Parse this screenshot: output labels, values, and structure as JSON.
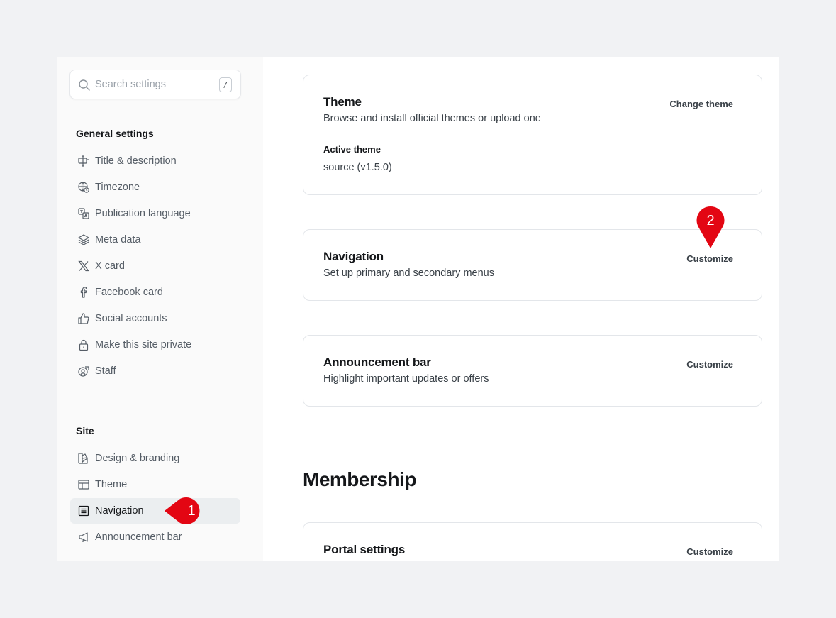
{
  "search": {
    "placeholder": "Search settings",
    "shortcut": "/"
  },
  "sidebar": {
    "general_title": "General settings",
    "general_items": [
      {
        "label": "Title & description",
        "icon": "title-icon"
      },
      {
        "label": "Timezone",
        "icon": "globe-clock-icon"
      },
      {
        "label": "Publication language",
        "icon": "language-icon"
      },
      {
        "label": "Meta data",
        "icon": "layers-icon"
      },
      {
        "label": "X card",
        "icon": "x-logo-icon"
      },
      {
        "label": "Facebook card",
        "icon": "facebook-icon"
      },
      {
        "label": "Social accounts",
        "icon": "thumbs-up-icon"
      },
      {
        "label": "Make this site private",
        "icon": "lock-icon"
      },
      {
        "label": "Staff",
        "icon": "staff-icon"
      }
    ],
    "site_title": "Site",
    "site_items": [
      {
        "label": "Design & branding",
        "icon": "paintbrush-icon"
      },
      {
        "label": "Theme",
        "icon": "layout-icon"
      },
      {
        "label": "Navigation",
        "icon": "navigation-list-icon",
        "active": true
      },
      {
        "label": "Announcement bar",
        "icon": "megaphone-icon"
      }
    ]
  },
  "main": {
    "theme_card": {
      "title": "Theme",
      "description": "Browse and install official themes or upload one",
      "action": "Change theme",
      "active_label": "Active theme",
      "active_value": "source (v1.5.0)"
    },
    "navigation_card": {
      "title": "Navigation",
      "description": "Set up primary and secondary menus",
      "action": "Customize"
    },
    "announcement_card": {
      "title": "Announcement bar",
      "description": "Highlight important updates or offers",
      "action": "Customize"
    },
    "membership_heading": "Membership",
    "portal_card": {
      "title": "Portal settings",
      "action": "Customize"
    }
  },
  "markers": [
    {
      "number": "1",
      "color": "#e30613"
    },
    {
      "number": "2",
      "color": "#e30613"
    }
  ]
}
